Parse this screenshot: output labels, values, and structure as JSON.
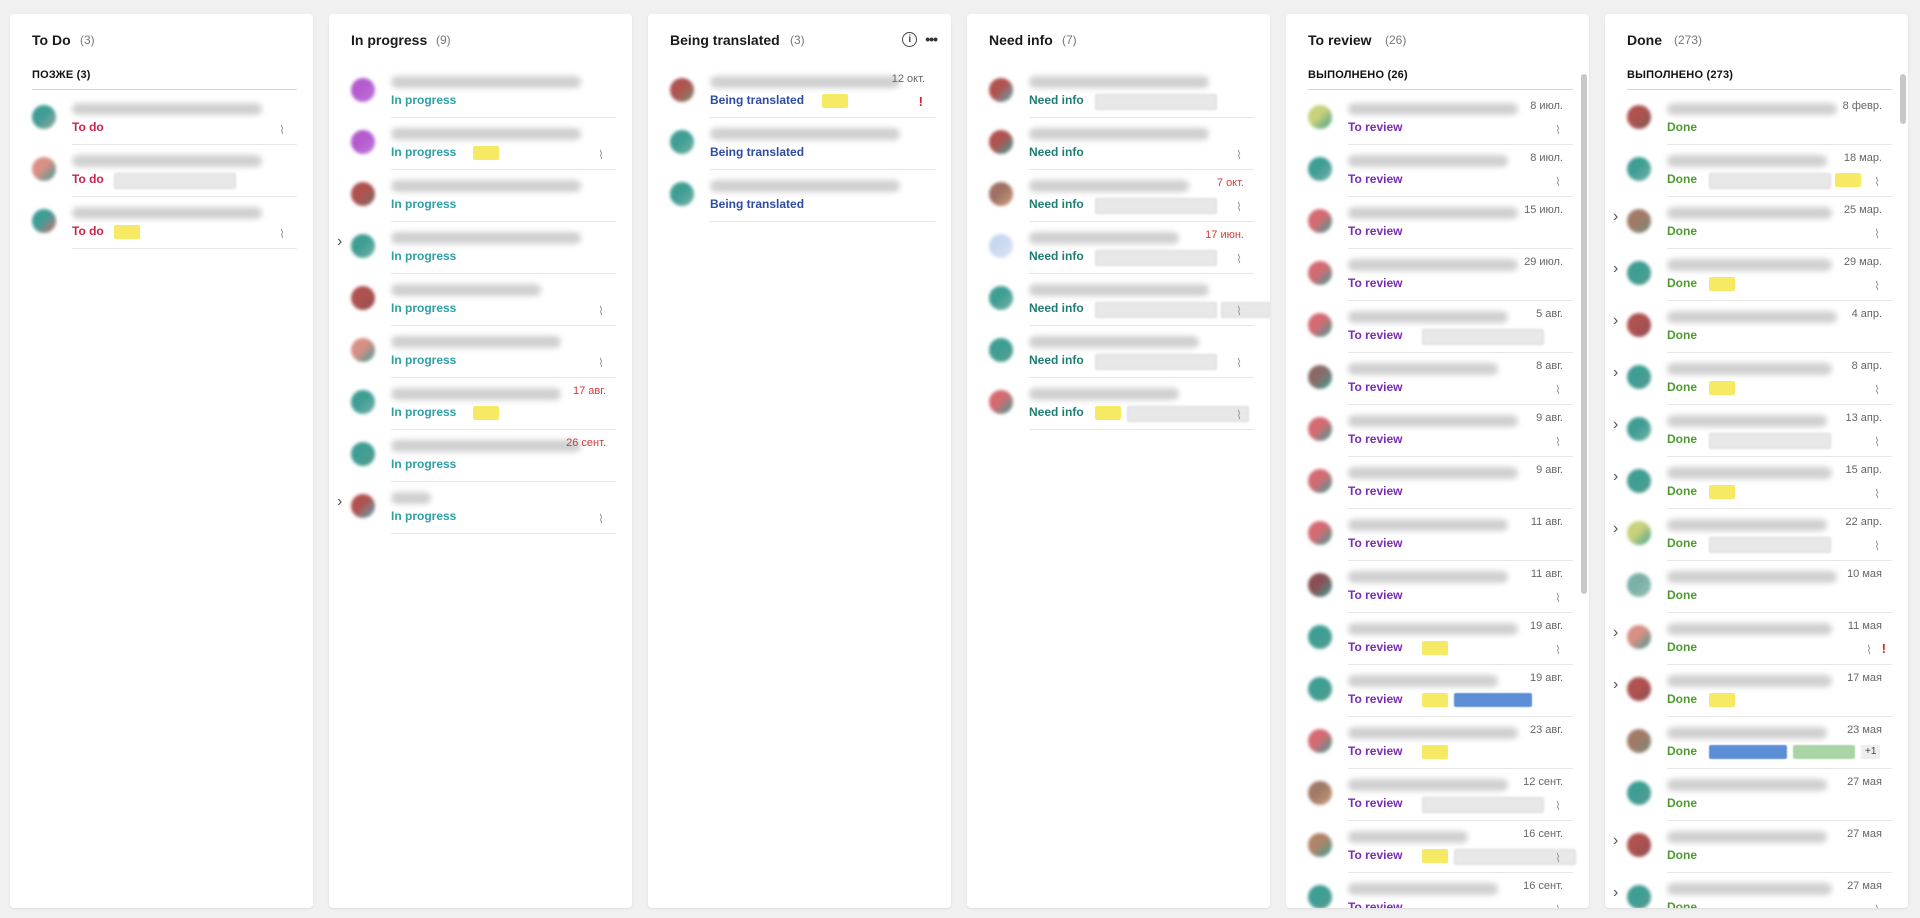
{
  "columns": [
    {
      "title": "To Do",
      "count": "(3)",
      "group": "ПОЗЖЕ (3)",
      "status_color": "#c8234b",
      "cards": [
        {
          "status": "To do",
          "avatar": [
            "#3e9e94",
            "#9aa5a0"
          ],
          "clip": true
        },
        {
          "status": "To do",
          "avatar": [
            "#d98f85",
            "#3e9e94"
          ],
          "tags": [
            "grey"
          ]
        },
        {
          "status": "To do",
          "avatar": [
            "#3e9e94",
            "#d66a72"
          ],
          "tags": [
            "yellow"
          ],
          "clip": true
        }
      ]
    },
    {
      "title": "In progress",
      "count": "(9)",
      "status_color": "#2f9fa6",
      "cards": [
        {
          "status": "In progress",
          "avatar": [
            "#b45bd0",
            "#c07ad8"
          ]
        },
        {
          "status": "In progress",
          "avatar": [
            "#b45bd0",
            "#c07ad8"
          ],
          "tags": [
            "yellow"
          ],
          "clip": true
        },
        {
          "status": "In progress",
          "avatar": [
            "#b0524f",
            "#7a6a66"
          ]
        },
        {
          "status": "In progress",
          "avatar": [
            "#3e9e94",
            "#7ab0a8"
          ],
          "expand": true
        },
        {
          "status": "In progress",
          "avatar": [
            "#b0524f",
            "#8c4f55"
          ],
          "clip": true
        },
        {
          "status": "In progress",
          "avatar": [
            "#d98f85",
            "#3e9e94"
          ],
          "clip": true
        },
        {
          "status": "In progress",
          "avatar": [
            "#3e9e94",
            "#7ab0a8"
          ],
          "tags": [
            "yellow"
          ],
          "date": "17 авг.",
          "date_red": true
        },
        {
          "status": "In progress",
          "avatar": [
            "#3e9e94",
            "#5a9a8e"
          ],
          "date": "26 сент.",
          "date_red": true
        },
        {
          "status": "In progress",
          "avatar": [
            "#b0524f",
            "#5aa9b5"
          ],
          "expand": true,
          "clip": true
        }
      ]
    },
    {
      "title": "Being translated",
      "count": "(3)",
      "status_color": "#2e4da0",
      "cards": [
        {
          "status": "Being translated",
          "avatar": [
            "#b0524f",
            "#7a8a70"
          ],
          "tags": [
            "yellow"
          ],
          "date": "12 окт.",
          "alert": true
        },
        {
          "status": "Being translated",
          "avatar": [
            "#3e9e94",
            "#7ab0a8"
          ]
        },
        {
          "status": "Being translated",
          "avatar": [
            "#3e9e94",
            "#7ab0a8"
          ]
        }
      ]
    },
    {
      "title": "Need info",
      "count": "(7)",
      "status_color": "#1f7d74",
      "cards": [
        {
          "status": "Need info",
          "avatar": [
            "#b0524f",
            "#5aa9b5"
          ],
          "tags": [
            "grey"
          ]
        },
        {
          "status": "Need info",
          "avatar": [
            "#b0524f",
            "#3e9e94"
          ],
          "clip": true
        },
        {
          "status": "Need info",
          "avatar": [
            "#a07066",
            "#c8a080"
          ],
          "tags": [
            "grey"
          ],
          "date": "7 окт.",
          "date_red": true,
          "clip": true
        },
        {
          "status": "Need info",
          "avatar": [
            "#c8d8f0",
            "#dfe6f5"
          ],
          "tags": [
            "grey"
          ],
          "date": "17 июн.",
          "date_red": true,
          "clip": true
        },
        {
          "status": "Need info",
          "avatar": [
            "#3e9e94",
            "#7ab0a8"
          ],
          "tags": [
            "grey",
            "grey"
          ],
          "clip": true
        },
        {
          "status": "Need info",
          "avatar": [
            "#3e9e94",
            "#5a9a8e"
          ],
          "tags": [
            "grey"
          ],
          "clip": true
        },
        {
          "status": "Need info",
          "avatar": [
            "#d66a72",
            "#3e9e94"
          ],
          "tags": [
            "yellow",
            "grey"
          ],
          "clip": true
        }
      ]
    },
    {
      "title": "To review",
      "count": "(26)",
      "group": "ВЫПОЛНЕНО (26)",
      "status_color": "#7b2bb3",
      "cards": [
        {
          "status": "To review",
          "avatar": [
            "#c9d27a",
            "#3e9e94"
          ],
          "date": "8 июл.",
          "clip": true
        },
        {
          "status": "To review",
          "avatar": [
            "#3e9e94",
            "#7ab0a8"
          ],
          "date": "8 июл.",
          "clip": true
        },
        {
          "status": "To review",
          "avatar": [
            "#d66a72",
            "#3e9e94"
          ],
          "date": "15 июл."
        },
        {
          "status": "To review",
          "avatar": [
            "#d66a72",
            "#3e9e94"
          ],
          "date": "29 июл."
        },
        {
          "status": "To review",
          "avatar": [
            "#d66a72",
            "#3e9e94"
          ],
          "tags": [
            "grey"
          ],
          "date": "5 авг."
        },
        {
          "status": "To review",
          "avatar": [
            "#8a6a66",
            "#3e9e94"
          ],
          "date": "8 авг.",
          "clip": true
        },
        {
          "status": "To review",
          "avatar": [
            "#d66a72",
            "#3e9e94"
          ],
          "date": "9 авг.",
          "clip": true
        },
        {
          "status": "To review",
          "avatar": [
            "#d66a72",
            "#3e9e94"
          ],
          "date": "9 авг."
        },
        {
          "status": "To review",
          "avatar": [
            "#d66a72",
            "#3e9e94"
          ],
          "date": "11 авг."
        },
        {
          "status": "To review",
          "avatar": [
            "#8a4f55",
            "#3e9e94"
          ],
          "date": "11 авг.",
          "clip": true
        },
        {
          "status": "To review",
          "avatar": [
            "#3e9e94",
            "#5a9a8e"
          ],
          "tags": [
            "yellow"
          ],
          "date": "19 авг.",
          "clip": true
        },
        {
          "status": "To review",
          "avatar": [
            "#3e9e94",
            "#5a9a8e"
          ],
          "tags": [
            "yellow",
            "blue"
          ],
          "date": "19 авг."
        },
        {
          "status": "To review",
          "avatar": [
            "#d66a72",
            "#3e9e94"
          ],
          "tags": [
            "yellow"
          ],
          "date": "23 авг."
        },
        {
          "status": "To review",
          "avatar": [
            "#a07a66",
            "#c8a080"
          ],
          "tags": [
            "grey"
          ],
          "date": "12 сент.",
          "clip": true
        },
        {
          "status": "To review",
          "avatar": [
            "#b0846a",
            "#3e9e94"
          ],
          "tags": [
            "yellow",
            "grey"
          ],
          "date": "16 сент.",
          "clip": true
        },
        {
          "status": "To review",
          "avatar": [
            "#3e9e94",
            "#5a9a8e"
          ],
          "date": "16 сент.",
          "clip": true
        }
      ]
    },
    {
      "title": "Done",
      "count": "(273)",
      "group": "ВЫПОЛНЕНО (273)",
      "status_color": "#4e9a2f",
      "cards": [
        {
          "status": "Done",
          "avatar": [
            "#b0524f",
            "#7a5a56"
          ],
          "date": "8 февр."
        },
        {
          "status": "Done",
          "avatar": [
            "#3e9e94",
            "#7ab0a8"
          ],
          "tags": [
            "grey",
            "yellow"
          ],
          "date": "18 мар.",
          "clip": true
        },
        {
          "status": "Done",
          "avatar": [
            "#a07a66",
            "#7a8a80"
          ],
          "date": "25 мар.",
          "clip": true,
          "expand": true
        },
        {
          "status": "Done",
          "avatar": [
            "#3e9e94",
            "#5a9a8e"
          ],
          "tags": [
            "yellow"
          ],
          "date": "29 мар.",
          "clip": true,
          "expand": true
        },
        {
          "status": "Done",
          "avatar": [
            "#b0524f",
            "#8a4f55"
          ],
          "date": "4 апр.",
          "expand": true
        },
        {
          "status": "Done",
          "avatar": [
            "#3e9e94",
            "#5a9a8e"
          ],
          "tags": [
            "yellow"
          ],
          "date": "8 апр.",
          "clip": true,
          "expand": true
        },
        {
          "status": "Done",
          "avatar": [
            "#3e9e94",
            "#7ab0a8"
          ],
          "tags": [
            "grey"
          ],
          "date": "13 апр.",
          "clip": true,
          "expand": true
        },
        {
          "status": "Done",
          "avatar": [
            "#3e9e94",
            "#5a9a8e"
          ],
          "tags": [
            "yellow"
          ],
          "date": "15 апр.",
          "clip": true,
          "expand": true
        },
        {
          "status": "Done",
          "avatar": [
            "#c9d27a",
            "#3e9e94"
          ],
          "tags": [
            "grey"
          ],
          "date": "22 апр.",
          "clip": true,
          "expand": true
        },
        {
          "status": "Done",
          "avatar": [
            "#7ab0a8",
            "#9ac0b8"
          ],
          "date": "10 мая"
        },
        {
          "status": "Done",
          "avatar": [
            "#d98f85",
            "#3e9e94"
          ],
          "date": "11 мая",
          "clip": true,
          "alert": true,
          "expand": true
        },
        {
          "status": "Done",
          "avatar": [
            "#b0524f",
            "#8a4f55"
          ],
          "tags": [
            "yellow"
          ],
          "date": "17 мая",
          "expand": true
        },
        {
          "status": "Done",
          "avatar": [
            "#a07a66",
            "#7a8a80"
          ],
          "tags": [
            "blue",
            "green"
          ],
          "plus": "+1",
          "date": "23 мая"
        },
        {
          "status": "Done",
          "avatar": [
            "#3e9e94",
            "#5a9a8e"
          ],
          "date": "27 мая"
        },
        {
          "status": "Done",
          "avatar": [
            "#b0524f",
            "#8a4f55"
          ],
          "date": "27 мая",
          "expand": true
        },
        {
          "status": "Done",
          "avatar": [
            "#3e9e94",
            "#5a9a8e"
          ],
          "date": "27 мая",
          "clip": true,
          "expand": true
        }
      ]
    }
  ]
}
